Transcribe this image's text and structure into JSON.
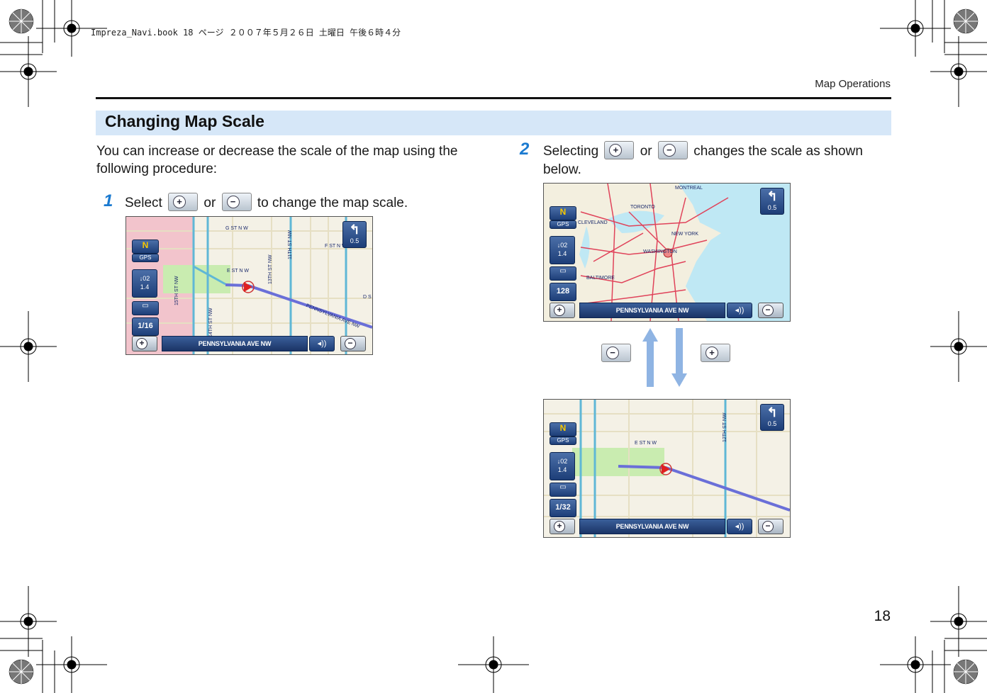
{
  "header": {
    "book_info": "Impreza_Navi.book  18 ページ  ２００７年５月２６日  土曜日  午後６時４分",
    "running_head": "Map Operations"
  },
  "section": {
    "title": "Changing Map Scale",
    "intro": "You can increase or decrease the scale of the map using the following procedure:"
  },
  "steps": [
    {
      "number": "1",
      "text_a": "Select",
      "text_b": "or",
      "text_c": "to change the map scale."
    },
    {
      "number": "2",
      "text_a": "Selecting",
      "text_b": "or",
      "text_c": "changes the scale as shown below."
    }
  ],
  "icons": {
    "zoom_in": "+",
    "zoom_out": "−",
    "volume": "◂))",
    "turn": "↰",
    "gps_icon": "N"
  },
  "maps": {
    "step1": {
      "gps_label": "GPS",
      "distance_top": "↓02",
      "distance_bottom": "1.4",
      "scale": "1/16",
      "turn_distance": "0.5",
      "street": "PENNSYLVANIA AVE NW",
      "labels": [
        "G ST N W",
        "F ST N W",
        "E ST N W",
        "15TH ST NW",
        "13TH ST NW",
        "11TH ST NW",
        "14TH ST NW",
        "PENNSYLVANIA AVE NW",
        "D S"
      ]
    },
    "small_scale": {
      "gps_label": "GPS",
      "distance_top": "↓02",
      "distance_bottom": "1.4",
      "scale": "128",
      "turn_distance": "0.5",
      "street": "PENNSYLVANIA AVE NW",
      "labels": [
        "MONTREAL",
        "TORONTO",
        "NEW YORK",
        "WASHINGTON",
        "BALTIMORE",
        "CLEVELAND"
      ]
    },
    "large_scale": {
      "gps_label": "GPS",
      "distance_top": "↓02",
      "distance_bottom": "1.4",
      "scale": "1/32",
      "turn_distance": "0.5",
      "street": "PENNSYLVANIA AVE NW",
      "labels": [
        "E ST N W",
        "12TH ST NW"
      ]
    }
  },
  "page_number": "18",
  "colors": {
    "accent": "#1a7ad0",
    "section_bar": "#d6e7f8",
    "arrow": "#8fb4e3"
  }
}
